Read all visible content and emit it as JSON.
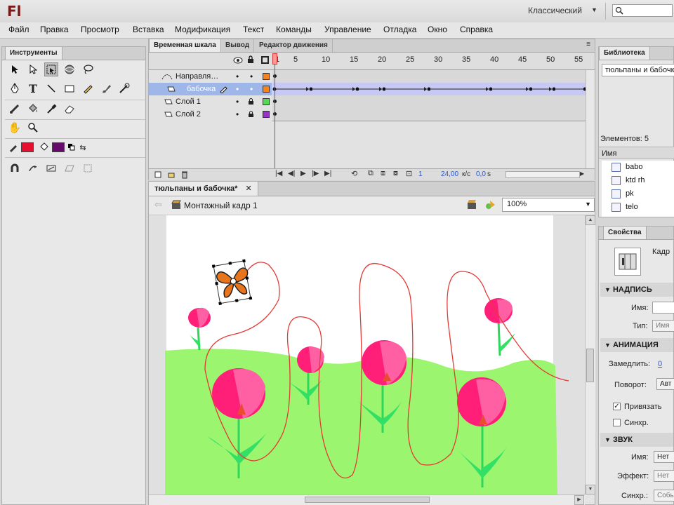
{
  "app": {
    "logo": "Fl",
    "workspace": "Классический"
  },
  "menu": [
    "Файл",
    "Правка",
    "Просмотр",
    "Вставка",
    "Модификация",
    "Текст",
    "Команды",
    "Управление",
    "Отладка",
    "Окно",
    "Справка"
  ],
  "tools_panel": {
    "title": "Инструменты",
    "stroke_color": "#e8102f",
    "fill_color": "#650a6b"
  },
  "timeline": {
    "tabs": [
      "Временная шкала",
      "Вывод",
      "Редактор движения"
    ],
    "frame_numbers": [
      "1",
      "5",
      "10",
      "15",
      "20",
      "25",
      "30",
      "35",
      "40",
      "45",
      "50",
      "55"
    ],
    "layers": [
      {
        "name": "Направля…",
        "color": "#f5841f"
      },
      {
        "name": "бабочка",
        "color": "#f5841f"
      },
      {
        "name": "Слой 1",
        "color": "#55d855"
      },
      {
        "name": "Слой 2",
        "color": "#9b33c7"
      }
    ],
    "current_frame": "1",
    "fps": "24,00",
    "fps_unit": "к/с",
    "time": "0,0",
    "time_unit": "s"
  },
  "document": {
    "tab": "тюльпаны и бабочка*",
    "scene": "Монтажный кадр 1",
    "zoom": "100%"
  },
  "library": {
    "title": "Библиотека",
    "doc": "тюльпаны и бабочк",
    "count_label": "Элементов: 5",
    "column": "Имя",
    "items": [
      "babo",
      "ktd rh",
      "pk",
      "telo"
    ]
  },
  "properties": {
    "title": "Свойства",
    "frame_label": "Кадр",
    "section_label": "НАДПИСЬ",
    "name_label": "Имя:",
    "type_label": "Тип:",
    "type_value": "Имя",
    "section_animation": "АНИМАЦИЯ",
    "ease_label": "Замедлить:",
    "ease_value": "0",
    "rotate_label": "Поворот:",
    "rotate_value": "Авт",
    "snap_label": "Привязать",
    "sync_label": "Синхр.",
    "section_sound": "ЗВУК",
    "sound_name_label": "Имя:",
    "sound_name_value": "Нет",
    "effect_label": "Эффект:",
    "effect_value": "Нет",
    "sound_sync_label": "Синхр.:",
    "sound_sync_value": "Событ"
  }
}
